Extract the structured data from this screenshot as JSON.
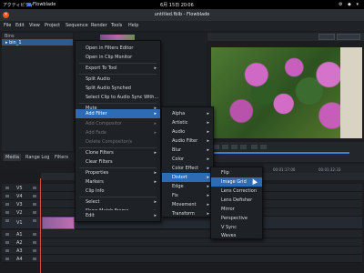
{
  "system": {
    "activities": "アクティビティ",
    "app_name": "Flowblade",
    "clock": "6月 15日 20∶06",
    "indicators": "⚙ ◆ ▾"
  },
  "window": {
    "title": "untitled.fblb - Flowblade"
  },
  "menubar": [
    "File",
    "Edit",
    "View",
    "Project",
    "Sequence",
    "Render",
    "Tools",
    "Help"
  ],
  "bins": {
    "header": "Bins",
    "selected": "▸ bin_1"
  },
  "media_tabs": [
    "Media",
    "Range Log",
    "Filters"
  ],
  "timeline": {
    "tracks": [
      "V5",
      "V4",
      "V3",
      "V2",
      "V1",
      "A1",
      "A2",
      "A3",
      "A4"
    ]
  },
  "info": {
    "in": "00:01:17:00",
    "out": "00:01:32:33"
  },
  "context_menu": {
    "items": [
      {
        "label": "Open in Filters Editor",
        "disabled": false,
        "submenu": false
      },
      {
        "label": "Open in Clip Monitor",
        "disabled": false,
        "submenu": false
      },
      {
        "label": "Export To Tool",
        "disabled": false,
        "submenu": true
      },
      {
        "label": "Split Audio",
        "disabled": false,
        "submenu": false
      },
      {
        "label": "Split Audio Synched",
        "disabled": false,
        "submenu": false
      },
      {
        "label": "Select Clip to Audio Sync With...",
        "disabled": false,
        "submenu": false
      },
      {
        "label": "Mute",
        "disabled": false,
        "submenu": true
      },
      {
        "label": "Add Filter",
        "disabled": false,
        "submenu": true,
        "highlighted": true
      },
      {
        "label": "Add Compositor",
        "disabled": true,
        "submenu": true
      },
      {
        "label": "Add Fade",
        "disabled": true,
        "submenu": true
      },
      {
        "label": "Delete Compositor/s",
        "disabled": true,
        "submenu": false
      },
      {
        "label": "Clone Filters",
        "disabled": false,
        "submenu": true
      },
      {
        "label": "Clear Filters",
        "disabled": false,
        "submenu": false
      },
      {
        "label": "Properties",
        "disabled": false,
        "submenu": true
      },
      {
        "label": "Markers",
        "disabled": false,
        "submenu": true
      },
      {
        "label": "Clip Info",
        "disabled": false,
        "submenu": false
      },
      {
        "label": "Select",
        "disabled": false,
        "submenu": true
      },
      {
        "label": "Show Match Frame",
        "disabled": false,
        "submenu": true
      },
      {
        "label": "Edit",
        "disabled": false,
        "submenu": true
      }
    ]
  },
  "filter_menu": {
    "items": [
      {
        "label": "Alpha"
      },
      {
        "label": "Artistic"
      },
      {
        "label": "Audio"
      },
      {
        "label": "Audio Filter"
      },
      {
        "label": "Blur"
      },
      {
        "label": "Color"
      },
      {
        "label": "Color Effect"
      },
      {
        "label": "Distort",
        "highlighted": true
      },
      {
        "label": "Edge"
      },
      {
        "label": "Fix"
      },
      {
        "label": "Movement"
      },
      {
        "label": "Transform"
      }
    ]
  },
  "distort_menu": {
    "items": [
      {
        "label": "Flip"
      },
      {
        "label": "Image Grid",
        "highlighted": true
      },
      {
        "label": "Lens Correction"
      },
      {
        "label": "Lens Defisher"
      },
      {
        "label": "Mirror"
      },
      {
        "label": "Perspective"
      },
      {
        "label": "V Sync"
      },
      {
        "label": "Waves"
      }
    ]
  }
}
